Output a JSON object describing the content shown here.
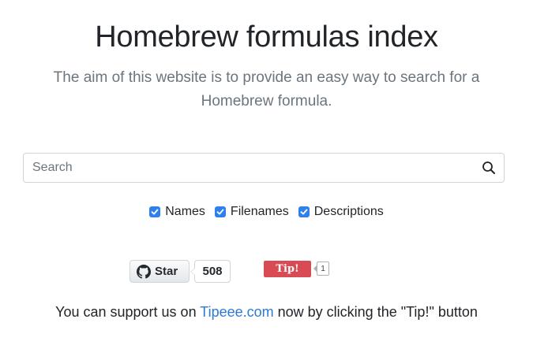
{
  "header": {
    "title": "Homebrew formulas index",
    "subtitle": "The aim of this website is to provide an easy way to search for a Homebrew formula."
  },
  "search": {
    "placeholder": "Search",
    "value": "",
    "icon": "search-icon"
  },
  "filters": [
    {
      "label": "Names",
      "checked": true
    },
    {
      "label": "Filenames",
      "checked": true
    },
    {
      "label": "Descriptions",
      "checked": true
    }
  ],
  "github": {
    "star_label": "Star",
    "star_count": "508",
    "icon": "github-icon"
  },
  "tipeee": {
    "tip_label": "Tip!",
    "tip_count": "1"
  },
  "support": {
    "prefix": "You can support us on ",
    "link_text": "Tipeee.com",
    "suffix": " now by clicking the \"Tip!\" button"
  },
  "colors": {
    "accent": "#2f80ed",
    "link": "#2b7ad3",
    "tip_red": "#d94b54",
    "subtitle_gray": "#6c757d"
  }
}
